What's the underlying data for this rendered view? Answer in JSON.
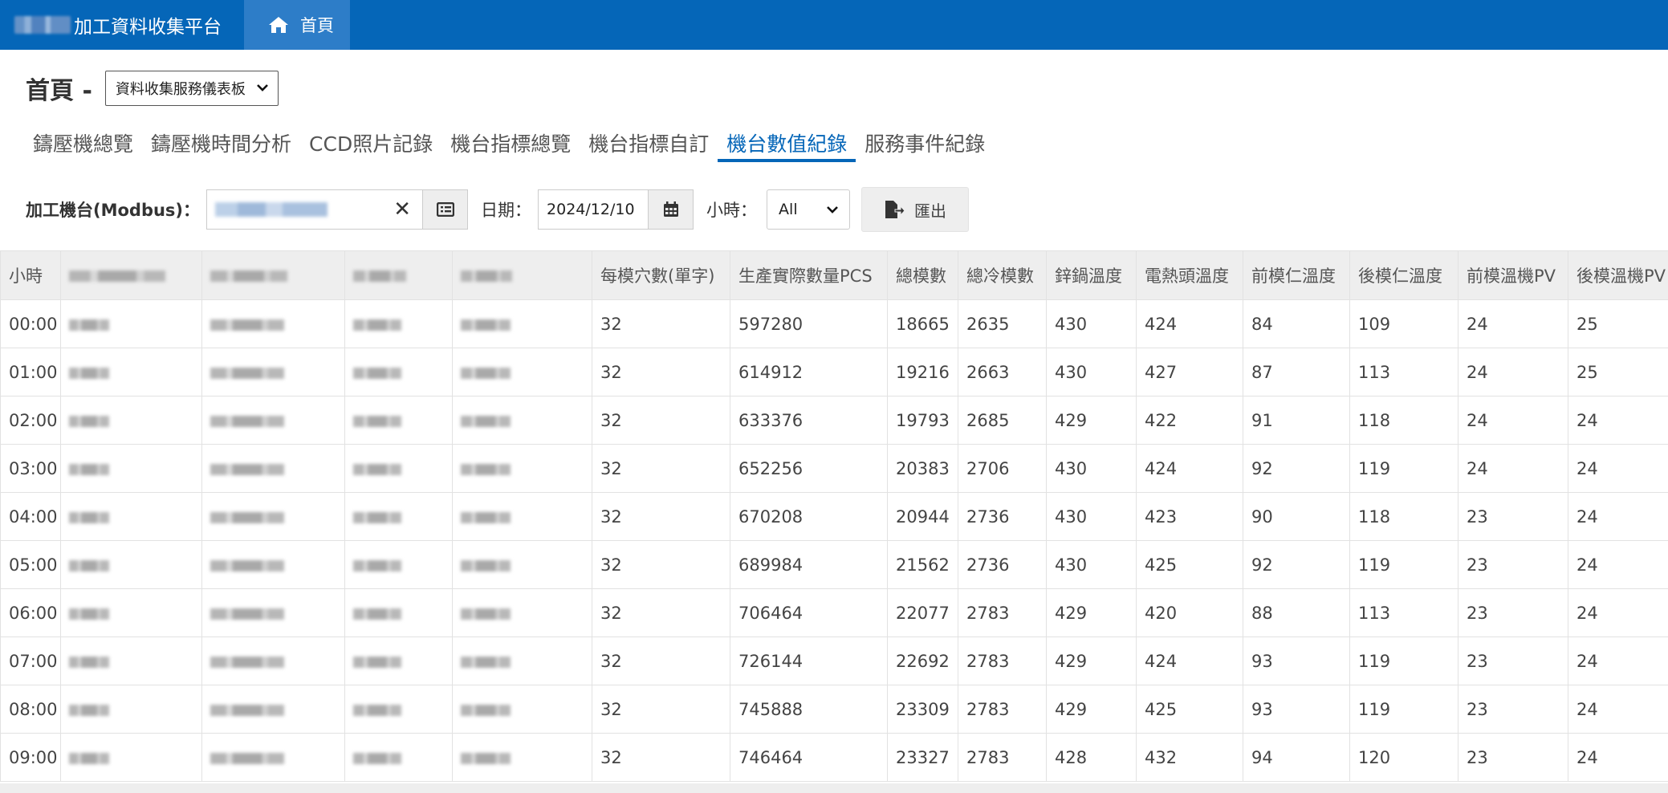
{
  "navbar": {
    "brand_text": "加工資料收集平台",
    "home_label": "首頁"
  },
  "header": {
    "title": "首頁 -",
    "select_value": "資料收集服務儀表板"
  },
  "tabs": [
    {
      "label": "鑄壓機總覽",
      "active": false
    },
    {
      "label": "鑄壓機時間分析",
      "active": false
    },
    {
      "label": "CCD照片記錄",
      "active": false
    },
    {
      "label": "機台指標總覽",
      "active": false
    },
    {
      "label": "機台指標自訂",
      "active": false
    },
    {
      "label": "機台數值紀錄",
      "active": true
    },
    {
      "label": "服務事件紀錄",
      "active": false
    }
  ],
  "filters": {
    "machine_label": "加工機台(Modbus)：",
    "clear_symbol": "✕",
    "date_label": "日期：",
    "date_value": "2024/12/10",
    "hour_label": "小時：",
    "hour_value": "All",
    "export_label": "匯出"
  },
  "table": {
    "headers": [
      "小時",
      "",
      "",
      "",
      "",
      "每模穴數(單字)",
      "生產實際數量PCS",
      "總模數",
      "總冷模數",
      "鋅鍋溫度",
      "電熱頭溫度",
      "前模仁溫度",
      "後模仁溫度",
      "前模溫機PV",
      "後模溫機PV"
    ],
    "rows": [
      [
        "00:00",
        "",
        "",
        "",
        "",
        "32",
        "597280",
        "18665",
        "2635",
        "430",
        "424",
        "84",
        "109",
        "24",
        "25"
      ],
      [
        "01:00",
        "",
        "",
        "",
        "",
        "32",
        "614912",
        "19216",
        "2663",
        "430",
        "427",
        "87",
        "113",
        "24",
        "25"
      ],
      [
        "02:00",
        "",
        "",
        "",
        "",
        "32",
        "633376",
        "19793",
        "2685",
        "429",
        "422",
        "91",
        "118",
        "24",
        "24"
      ],
      [
        "03:00",
        "",
        "",
        "",
        "",
        "32",
        "652256",
        "20383",
        "2706",
        "430",
        "424",
        "92",
        "119",
        "24",
        "24"
      ],
      [
        "04:00",
        "",
        "",
        "",
        "",
        "32",
        "670208",
        "20944",
        "2736",
        "430",
        "423",
        "90",
        "118",
        "23",
        "24"
      ],
      [
        "05:00",
        "",
        "",
        "",
        "",
        "32",
        "689984",
        "21562",
        "2736",
        "430",
        "425",
        "92",
        "119",
        "23",
        "24"
      ],
      [
        "06:00",
        "",
        "",
        "",
        "",
        "32",
        "706464",
        "22077",
        "2783",
        "429",
        "420",
        "88",
        "113",
        "23",
        "24"
      ],
      [
        "07:00",
        "",
        "",
        "",
        "",
        "32",
        "726144",
        "22692",
        "2783",
        "429",
        "424",
        "93",
        "119",
        "23",
        "24"
      ],
      [
        "08:00",
        "",
        "",
        "",
        "",
        "32",
        "745888",
        "23309",
        "2783",
        "429",
        "425",
        "93",
        "119",
        "23",
        "24"
      ],
      [
        "09:00",
        "",
        "",
        "",
        "",
        "32",
        "746464",
        "23327",
        "2783",
        "428",
        "432",
        "94",
        "120",
        "23",
        "24"
      ]
    ]
  }
}
